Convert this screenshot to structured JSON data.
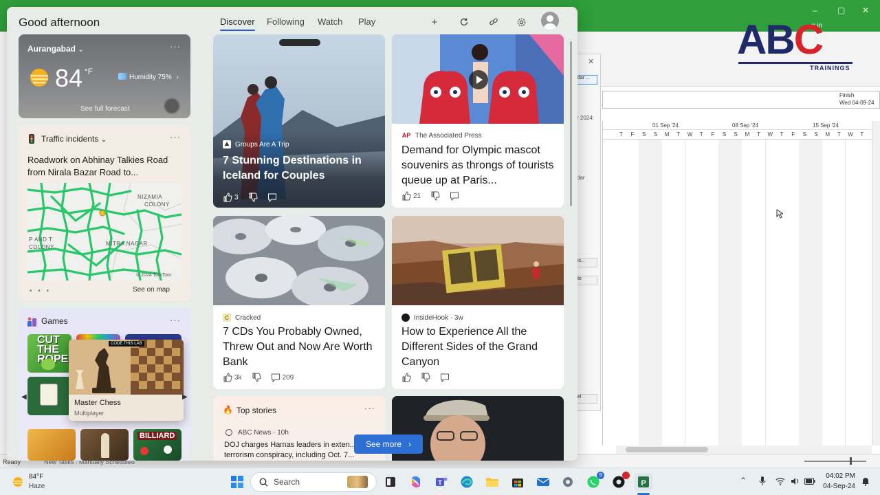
{
  "background_app": {
    "window_controls": [
      "–",
      "▢",
      "✕"
    ],
    "window_title_fragment": "n in",
    "dialog_close": "✕",
    "dialog_button_top": "dar ...",
    "dialog_label_year": "r 2024:",
    "dialog_label_calendar": "dar",
    "dialog_button_mid": "is...",
    "dialog_button_mid2": "te",
    "dialog_button_bottom": "el",
    "finish_label": "Finish",
    "finish_value": "Wed 04-09-24",
    "gantt_weeks": [
      "01 Sep '24",
      "08 Sep '24",
      "15 Sep '24"
    ],
    "gantt_days": [
      "T",
      "F",
      "S",
      "S",
      "M",
      "T",
      "W",
      "T",
      "F",
      "S",
      "S",
      "M",
      "T",
      "W",
      "T",
      "F",
      "S",
      "S",
      "M",
      "T",
      "W",
      "T"
    ],
    "status_ready": "Ready",
    "status_new_tasks": "New Tasks : Manually Scheduled"
  },
  "logo": {
    "letters": [
      "A",
      "B",
      "C"
    ],
    "tagline": "TRAININGS",
    "colors": {
      "navy": "#1f2a6b",
      "red": "#d8232a"
    }
  },
  "widgets": {
    "greeting": "Good afternoon",
    "tabs": [
      {
        "label": "Discover",
        "active": true
      },
      {
        "label": "Following",
        "active": false
      },
      {
        "label": "Watch",
        "active": false
      },
      {
        "label": "Play",
        "active": false
      }
    ],
    "header_icons": [
      "plus-icon",
      "refresh-icon",
      "link-icon",
      "gear-icon",
      "avatar"
    ],
    "weather": {
      "location": "Aurangabad",
      "temperature": "84",
      "unit": "°F",
      "humidity": "Humidity 75%",
      "forecast_link": "See full forecast",
      "menu": "···"
    },
    "traffic": {
      "title": "Traffic incidents",
      "headline": "Roadwork on Abhinay Talkies Road from Nirala Bazar Road to...",
      "map_labels": [
        "NIZAMIA",
        "COLONY",
        "P AND T",
        "COLONY",
        "MITRA NAGAR"
      ],
      "map_copyright": "© 2024 TomTom",
      "see_on_map": "See on map",
      "pager": "• • •",
      "menu": "···"
    },
    "games": {
      "title": "Games",
      "featured_name": "Master Chess",
      "featured_sub": "Multiplayer",
      "featured_brand": "CODE THIS LAB",
      "tiles": [
        "CUT THE ROPE",
        "BILLIARD"
      ],
      "menu": "···"
    },
    "news": [
      {
        "source": "Groups Are A Trip",
        "headline": "7 Stunning Destinations in Iceland for Couples",
        "likes": "3"
      },
      {
        "source": "The Associated Press",
        "source_logo": "AP",
        "headline": "Demand for Olympic mascot souvenirs as throngs of tourists queue up at Paris...",
        "likes": "21"
      },
      {
        "source": "Cracked",
        "headline": "7 CDs You Probably Owned, Threw Out and Now Are Worth Bank",
        "likes": "3k",
        "comments": "209"
      },
      {
        "source": "InsideHook · 3w",
        "headline": "How to Experience All the Different Sides of the Grand Canyon",
        "likes": ""
      }
    ],
    "top_stories": {
      "title": "Top stories",
      "source": "ABC News · 10h",
      "headline": "DOJ charges Hamas leaders in exten... terrorism conspiracy, including Oct. 7...",
      "menu": "···"
    },
    "see_more": "See more"
  },
  "taskbar": {
    "weather_temp": "84°F",
    "weather_cond": "Haze",
    "search_placeholder": "Search",
    "apps": [
      "start-icon",
      "search",
      "widgets-icon",
      "task-view-icon",
      "copilot-icon",
      "teams-icon",
      "edge-icon",
      "file-explorer-icon",
      "store-icon",
      "mail-icon",
      "settings-icon",
      "whatsapp-icon",
      "app-icon",
      "project-icon"
    ],
    "whatsapp_badge": "9",
    "time": "04:02 PM",
    "date": "04-Sep-24"
  }
}
